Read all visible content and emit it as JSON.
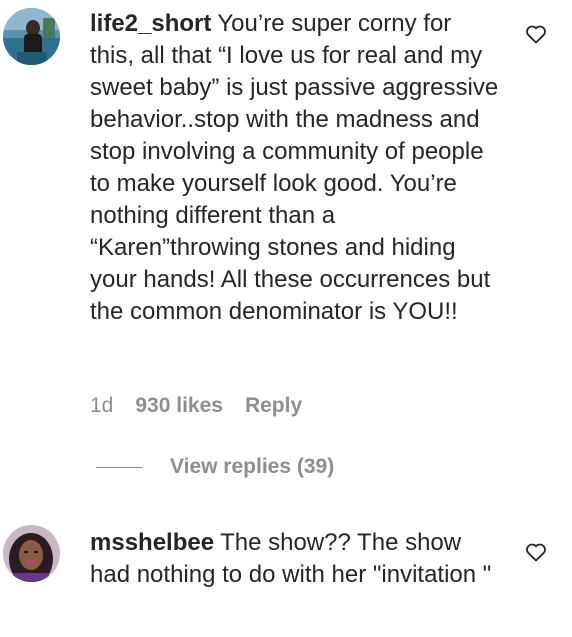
{
  "comments": [
    {
      "username": "life2_short",
      "text": "You’re super corny for this, all that “I love us for real and my sweet baby” is just passive aggressive behavior..stop with the madness and stop involving a community of people to make yourself look good. You’re nothing different than a “Karen”throwing stones and hiding your hands! All these occurrences but the common denominator is YOU!!",
      "age": "1d",
      "likes": "930 likes",
      "reply_label": "Reply",
      "view_replies": "View replies (39)",
      "avatar_icon": "user-avatar-photo",
      "like_icon": "heart-outline-icon"
    },
    {
      "username": "msshelbee",
      "text": "The show?? The show had nothing to do with her \"invitation \"",
      "avatar_icon": "user-avatar-photo",
      "like_icon": "heart-outline-icon"
    }
  ],
  "colors": {
    "text_primary": "#262626",
    "text_secondary": "#8e8e8e",
    "background": "#ffffff"
  }
}
